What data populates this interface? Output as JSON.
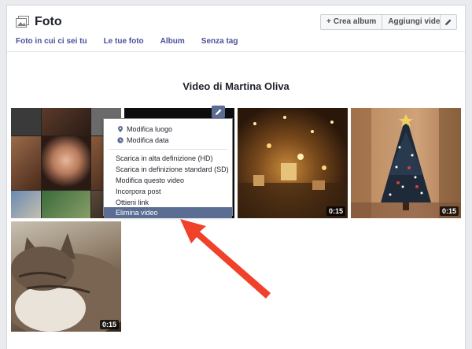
{
  "header": {
    "title": "Foto",
    "tabs": [
      "Foto in cui ci sei tu",
      "Le tue foto",
      "Album",
      "Senza tag"
    ],
    "create_album_label": "Crea album",
    "add_video_label": "Aggiungi video"
  },
  "section": {
    "title": "Video di Martina Oliva"
  },
  "videos": [
    {
      "duration": ""
    },
    {
      "duration": ""
    },
    {
      "duration": "0:15"
    },
    {
      "duration": "0:15"
    },
    {
      "duration": "0:15"
    }
  ],
  "menu": {
    "items": [
      {
        "label": "Modifica luogo",
        "icon": "location-pin-icon"
      },
      {
        "label": "Modifica data",
        "icon": "clock-icon"
      },
      {
        "label": "Scarica in alta definizione (HD)"
      },
      {
        "label": "Scarica in definizione standard (SD)"
      },
      {
        "label": "Modifica questo video"
      },
      {
        "label": "Incorpora post"
      },
      {
        "label": "Ottieni link"
      },
      {
        "label": "Elimina video",
        "active": true
      }
    ]
  },
  "colors": {
    "link": "#4b4f9a",
    "menu_highlight": "#5b6d93",
    "annotation_arrow": "#f0412b"
  }
}
